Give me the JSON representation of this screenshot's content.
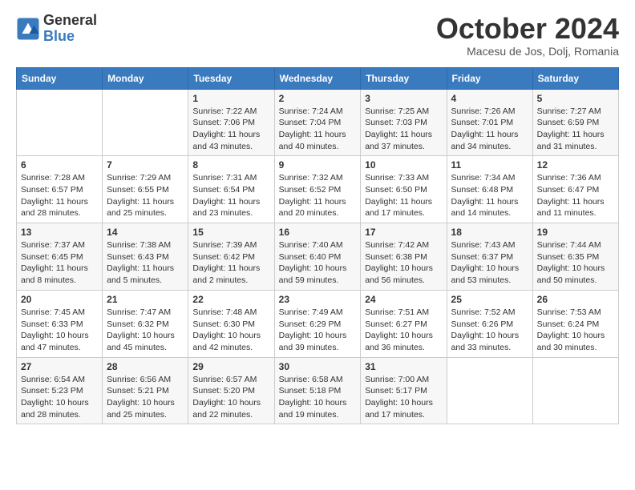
{
  "header": {
    "logo_line1": "General",
    "logo_line2": "Blue",
    "month_title": "October 2024",
    "location": "Macesu de Jos, Dolj, Romania"
  },
  "days_of_week": [
    "Sunday",
    "Monday",
    "Tuesday",
    "Wednesday",
    "Thursday",
    "Friday",
    "Saturday"
  ],
  "weeks": [
    [
      {
        "day": "",
        "content": ""
      },
      {
        "day": "",
        "content": ""
      },
      {
        "day": "1",
        "content": "Sunrise: 7:22 AM\nSunset: 7:06 PM\nDaylight: 11 hours and 43 minutes."
      },
      {
        "day": "2",
        "content": "Sunrise: 7:24 AM\nSunset: 7:04 PM\nDaylight: 11 hours and 40 minutes."
      },
      {
        "day": "3",
        "content": "Sunrise: 7:25 AM\nSunset: 7:03 PM\nDaylight: 11 hours and 37 minutes."
      },
      {
        "day": "4",
        "content": "Sunrise: 7:26 AM\nSunset: 7:01 PM\nDaylight: 11 hours and 34 minutes."
      },
      {
        "day": "5",
        "content": "Sunrise: 7:27 AM\nSunset: 6:59 PM\nDaylight: 11 hours and 31 minutes."
      }
    ],
    [
      {
        "day": "6",
        "content": "Sunrise: 7:28 AM\nSunset: 6:57 PM\nDaylight: 11 hours and 28 minutes."
      },
      {
        "day": "7",
        "content": "Sunrise: 7:29 AM\nSunset: 6:55 PM\nDaylight: 11 hours and 25 minutes."
      },
      {
        "day": "8",
        "content": "Sunrise: 7:31 AM\nSunset: 6:54 PM\nDaylight: 11 hours and 23 minutes."
      },
      {
        "day": "9",
        "content": "Sunrise: 7:32 AM\nSunset: 6:52 PM\nDaylight: 11 hours and 20 minutes."
      },
      {
        "day": "10",
        "content": "Sunrise: 7:33 AM\nSunset: 6:50 PM\nDaylight: 11 hours and 17 minutes."
      },
      {
        "day": "11",
        "content": "Sunrise: 7:34 AM\nSunset: 6:48 PM\nDaylight: 11 hours and 14 minutes."
      },
      {
        "day": "12",
        "content": "Sunrise: 7:36 AM\nSunset: 6:47 PM\nDaylight: 11 hours and 11 minutes."
      }
    ],
    [
      {
        "day": "13",
        "content": "Sunrise: 7:37 AM\nSunset: 6:45 PM\nDaylight: 11 hours and 8 minutes."
      },
      {
        "day": "14",
        "content": "Sunrise: 7:38 AM\nSunset: 6:43 PM\nDaylight: 11 hours and 5 minutes."
      },
      {
        "day": "15",
        "content": "Sunrise: 7:39 AM\nSunset: 6:42 PM\nDaylight: 11 hours and 2 minutes."
      },
      {
        "day": "16",
        "content": "Sunrise: 7:40 AM\nSunset: 6:40 PM\nDaylight: 10 hours and 59 minutes."
      },
      {
        "day": "17",
        "content": "Sunrise: 7:42 AM\nSunset: 6:38 PM\nDaylight: 10 hours and 56 minutes."
      },
      {
        "day": "18",
        "content": "Sunrise: 7:43 AM\nSunset: 6:37 PM\nDaylight: 10 hours and 53 minutes."
      },
      {
        "day": "19",
        "content": "Sunrise: 7:44 AM\nSunset: 6:35 PM\nDaylight: 10 hours and 50 minutes."
      }
    ],
    [
      {
        "day": "20",
        "content": "Sunrise: 7:45 AM\nSunset: 6:33 PM\nDaylight: 10 hours and 47 minutes."
      },
      {
        "day": "21",
        "content": "Sunrise: 7:47 AM\nSunset: 6:32 PM\nDaylight: 10 hours and 45 minutes."
      },
      {
        "day": "22",
        "content": "Sunrise: 7:48 AM\nSunset: 6:30 PM\nDaylight: 10 hours and 42 minutes."
      },
      {
        "day": "23",
        "content": "Sunrise: 7:49 AM\nSunset: 6:29 PM\nDaylight: 10 hours and 39 minutes."
      },
      {
        "day": "24",
        "content": "Sunrise: 7:51 AM\nSunset: 6:27 PM\nDaylight: 10 hours and 36 minutes."
      },
      {
        "day": "25",
        "content": "Sunrise: 7:52 AM\nSunset: 6:26 PM\nDaylight: 10 hours and 33 minutes."
      },
      {
        "day": "26",
        "content": "Sunrise: 7:53 AM\nSunset: 6:24 PM\nDaylight: 10 hours and 30 minutes."
      }
    ],
    [
      {
        "day": "27",
        "content": "Sunrise: 6:54 AM\nSunset: 5:23 PM\nDaylight: 10 hours and 28 minutes."
      },
      {
        "day": "28",
        "content": "Sunrise: 6:56 AM\nSunset: 5:21 PM\nDaylight: 10 hours and 25 minutes."
      },
      {
        "day": "29",
        "content": "Sunrise: 6:57 AM\nSunset: 5:20 PM\nDaylight: 10 hours and 22 minutes."
      },
      {
        "day": "30",
        "content": "Sunrise: 6:58 AM\nSunset: 5:18 PM\nDaylight: 10 hours and 19 minutes."
      },
      {
        "day": "31",
        "content": "Sunrise: 7:00 AM\nSunset: 5:17 PM\nDaylight: 10 hours and 17 minutes."
      },
      {
        "day": "",
        "content": ""
      },
      {
        "day": "",
        "content": ""
      }
    ]
  ]
}
